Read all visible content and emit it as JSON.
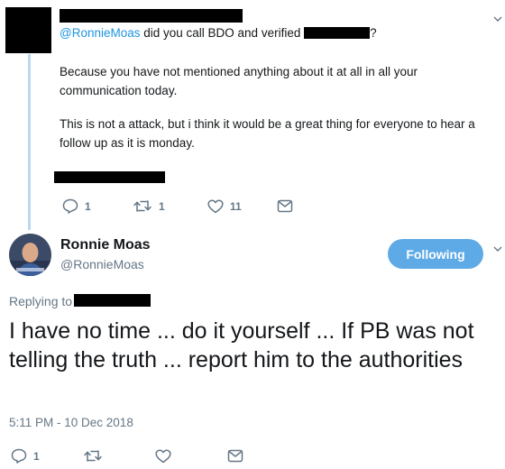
{
  "reply_tweet": {
    "mention": "@RonnieMoas",
    "text_before_redaction": " did you call BDO and verified ",
    "text_after_redaction": "?",
    "paragraph_1": "Because you have not mentioned anything about it at all in all your communication today.",
    "paragraph_2": "This is not a attack, but i think it would be a great thing for everyone to hear a follow up as it is monday.",
    "reply_count": "1",
    "retweet_count": "1",
    "like_count": "11"
  },
  "main_tweet": {
    "author_name": "Ronnie Moas",
    "author_handle": "@RonnieMoas",
    "follow_label": "Following",
    "replying_to_label": "Replying to",
    "text": "I have no time ... do it yourself ... If PB was not telling the truth ... report him to the authorities",
    "timestamp": "5:11 PM - 10 Dec 2018",
    "reply_count": "1"
  },
  "icons": [
    "reply-icon",
    "retweet-icon",
    "like-icon",
    "direct-message-icon",
    "chevron-down-icon"
  ],
  "colors": {
    "link": "#1b95e0",
    "follow_button": "#5eaae6",
    "thread_line": "#b9d9ef",
    "secondary_text": "#657786"
  }
}
